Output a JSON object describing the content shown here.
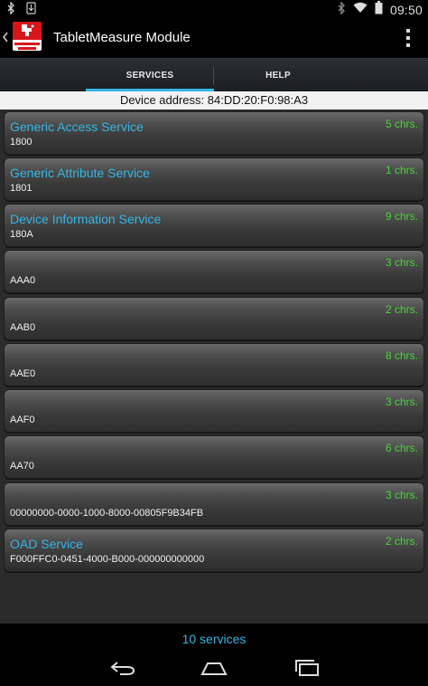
{
  "status_bar": {
    "time": "09:50",
    "left_icons": [
      "bluetooth-icon",
      "download-icon"
    ],
    "right_icons": [
      "bluetooth-icon",
      "wifi-icon",
      "battery-icon"
    ]
  },
  "action_bar": {
    "title": "TabletMeasure Module",
    "logo_text": "Bluetooth low energy"
  },
  "tabs": [
    {
      "label": "SERVICES",
      "selected": true
    },
    {
      "label": "HELP",
      "selected": false
    }
  ],
  "device_address": "Device address: 84:DD:20:F0:98:A3",
  "services": [
    {
      "name": "Generic Access Service",
      "uuid": "1800",
      "chrs": "5 chrs."
    },
    {
      "name": "Generic Attribute Service",
      "uuid": "1801",
      "chrs": "1 chrs."
    },
    {
      "name": "Device Information Service",
      "uuid": "180A",
      "chrs": "9 chrs."
    },
    {
      "name": "",
      "uuid": "AAA0",
      "chrs": "3 chrs."
    },
    {
      "name": "",
      "uuid": "AAB0",
      "chrs": "2 chrs."
    },
    {
      "name": "",
      "uuid": "AAE0",
      "chrs": "8 chrs."
    },
    {
      "name": "",
      "uuid": "AAF0",
      "chrs": "3 chrs."
    },
    {
      "name": "",
      "uuid": "AA70",
      "chrs": "6 chrs."
    },
    {
      "name": "",
      "uuid": "00000000-0000-1000-8000-00805F9B34FB",
      "chrs": "3 chrs."
    },
    {
      "name": "OAD Service",
      "uuid": "F000FFC0-0451-4000-B000-000000000000",
      "chrs": "2 chrs."
    }
  ],
  "services_count": "10 services",
  "colors": {
    "accent": "#35b5e5",
    "chrs_green": "#4ad43a",
    "logo_red": "#d8151b"
  },
  "nav_bar": {
    "icons": [
      "back-icon",
      "home-icon",
      "recents-icon"
    ]
  }
}
